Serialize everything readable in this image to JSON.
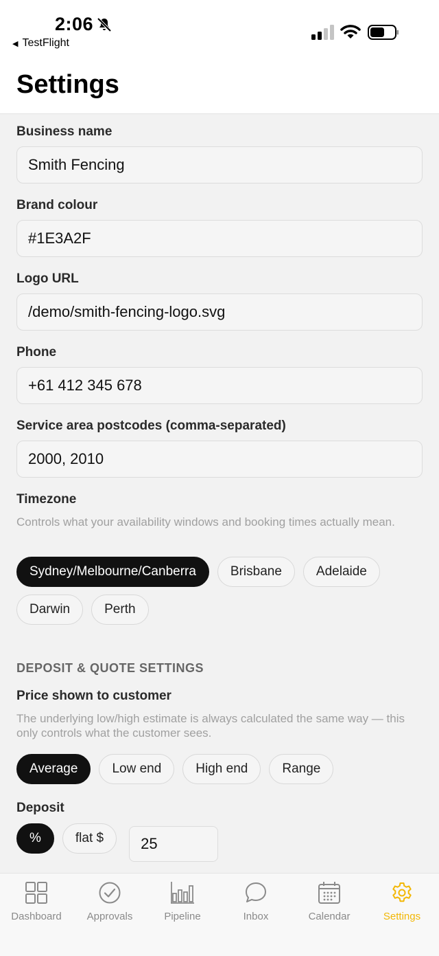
{
  "status_bar": {
    "time": "2:06",
    "back_label": "TestFlight"
  },
  "header": {
    "title": "Settings"
  },
  "form": {
    "business_name": {
      "label": "Business name",
      "value": "Smith Fencing"
    },
    "brand_colour": {
      "label": "Brand colour",
      "value": "#1E3A2F"
    },
    "logo_url": {
      "label": "Logo URL",
      "value": "/demo/smith-fencing-logo.svg"
    },
    "phone": {
      "label": "Phone",
      "value": "+61 412 345 678"
    },
    "postcodes": {
      "label": "Service area postcodes (comma-separated)",
      "value": "2000, 2010"
    }
  },
  "timezone": {
    "label": "Timezone",
    "helper": "Controls what your availability windows and booking times actually mean.",
    "options": [
      "Sydney/Melbourne/Canberra",
      "Brisbane",
      "Adelaide",
      "Darwin",
      "Perth"
    ],
    "selected": "Sydney/Melbourne/Canberra"
  },
  "deposit_section": {
    "title": "DEPOSIT & QUOTE SETTINGS",
    "price_label": "Price shown to customer",
    "price_helper": "The underlying low/high estimate is always calculated the same way — this only controls what the customer sees.",
    "price_options": [
      "Average",
      "Low end",
      "High end",
      "Range"
    ],
    "price_selected": "Average",
    "deposit_label": "Deposit",
    "deposit_options": [
      "%",
      "flat $"
    ],
    "deposit_selected": "%",
    "deposit_value": "25"
  },
  "tab_bar": {
    "tabs": [
      {
        "label": "Dashboard",
        "icon": "grid-icon"
      },
      {
        "label": "Approvals",
        "icon": "check-circle-icon"
      },
      {
        "label": "Pipeline",
        "icon": "bar-chart-icon"
      },
      {
        "label": "Inbox",
        "icon": "chat-bubble-icon"
      },
      {
        "label": "Calendar",
        "icon": "calendar-icon"
      },
      {
        "label": "Settings",
        "icon": "gear-icon"
      }
    ],
    "active": "Settings",
    "active_color": "#F2B705"
  }
}
